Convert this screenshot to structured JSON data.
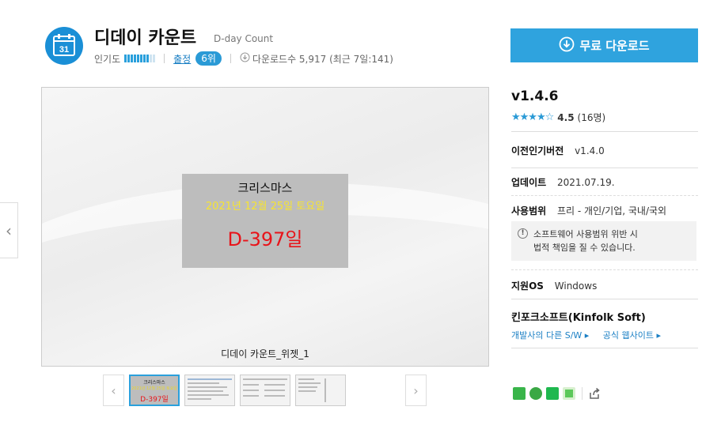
{
  "app": {
    "title": "디데이 카운트",
    "subtitle": "D-day Count",
    "icon_day": "31"
  },
  "meta": {
    "popularity_label": "인기도",
    "popularity_level": 0.8,
    "category_link": "출정",
    "rank_badge": "6위",
    "downloads_text": "다운로드수 5,917 (최근 7일:141)"
  },
  "download_button": {
    "label": "무료 다운로드"
  },
  "viewer": {
    "widget_name": "크리스마스",
    "widget_date": "2021년 12월 25일 토요일",
    "widget_dday": "D-397일",
    "caption": "디데이 카운트_위젯_1",
    "prev_arrow": "‹",
    "next_arrow": "›"
  },
  "thumbnails": {
    "first": {
      "name": "크리스마스",
      "date": "2021년 12월 25일 토요일",
      "dday": "D-397일"
    }
  },
  "info": {
    "version": "v1.4.6",
    "rating_value": "4.5",
    "rating_count": "(16명)",
    "rating_stars": "★★★★☆",
    "prev_version_label": "이전인기버전",
    "prev_version_value": "v1.4.0",
    "update_label": "업데이트",
    "update_value": "2021.07.19.",
    "usage_label": "사용범위",
    "usage_value": "프리 - 개인/기업, 국내/국외",
    "notice_line1": "소프트웨어 사용범위 위반 시",
    "notice_line2": "법적 책임을 질 수 있습니다.",
    "os_label": "지원OS",
    "os_value": "Windows",
    "developer": "킨포크소프트(Kinfolk Soft)",
    "dev_other_link": "개발사의 다른 S/W ▸",
    "dev_site_link": "공식 웹사이트 ▸"
  },
  "colors": {
    "accent": "#2fa3de",
    "link": "#1a7fc4",
    "widget_bg": "#bdbdbd",
    "dday_red": "#e8141a",
    "date_yellow": "#f7e431"
  },
  "icons": [
    "calendar-icon",
    "download-icon",
    "star-icon",
    "notice-icon",
    "share-band-icon",
    "share-kakaostory-icon",
    "share-naver-icon",
    "share-line-icon",
    "share-link-icon"
  ]
}
